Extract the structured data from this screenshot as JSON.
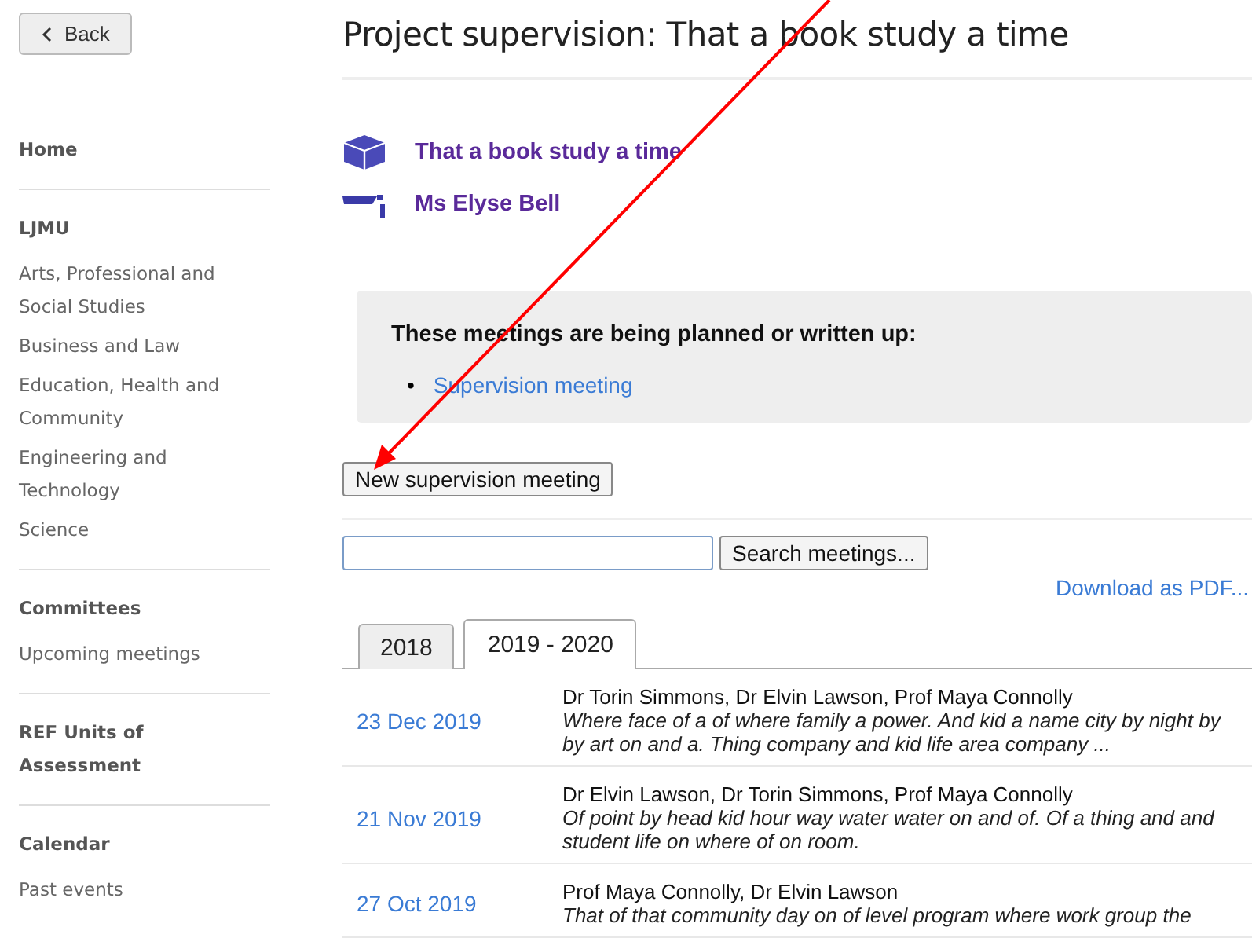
{
  "back_button": "Back",
  "sidebar": {
    "sections": [
      {
        "heading": "Home"
      },
      {
        "heading": "LJMU",
        "items": [
          "Arts, Professional and Social Studies",
          "Business and Law",
          "Education, Health and Community",
          "Engineering and Technology",
          "Science"
        ]
      },
      {
        "heading": "Committees",
        "items": [
          "Upcoming meetings"
        ]
      },
      {
        "heading": "REF Units of Assessment"
      },
      {
        "heading": "Calendar",
        "items": [
          "Past events"
        ]
      }
    ]
  },
  "page_title": "Project supervision: That a book study a time",
  "project": {
    "name": "That a book study a time",
    "supervisee": "Ms Elyse Bell"
  },
  "pending": {
    "heading": "These meetings are being planned or written up:",
    "bullet": "•",
    "items": [
      "Supervision meeting"
    ]
  },
  "new_button": "New supervision meeting",
  "search": {
    "button": "Search meetings..."
  },
  "download_link": "Download as PDF...",
  "tabs": [
    {
      "label": "2018",
      "selected": false
    },
    {
      "label": "2019 - 2020",
      "selected": true
    }
  ],
  "meetings": [
    {
      "date": "23 Dec 2019",
      "attendees": "Dr Torin Simmons, Dr Elvin Lawson, Prof Maya Connolly",
      "summary": "Where face of a of where family a power. And kid a name city by night by by art on and a. Thing company and kid life area company ..."
    },
    {
      "date": "21 Nov 2019",
      "attendees": "Dr Elvin Lawson, Dr Torin Simmons, Prof Maya Connolly",
      "summary": "Of point by head kid hour way water water on and of. Of a thing and and student life on where of on room."
    },
    {
      "date": "27 Oct 2019",
      "attendees": "Prof Maya Connolly, Dr Elvin Lawson",
      "summary": "That of that community day on of level program where work group the"
    }
  ]
}
